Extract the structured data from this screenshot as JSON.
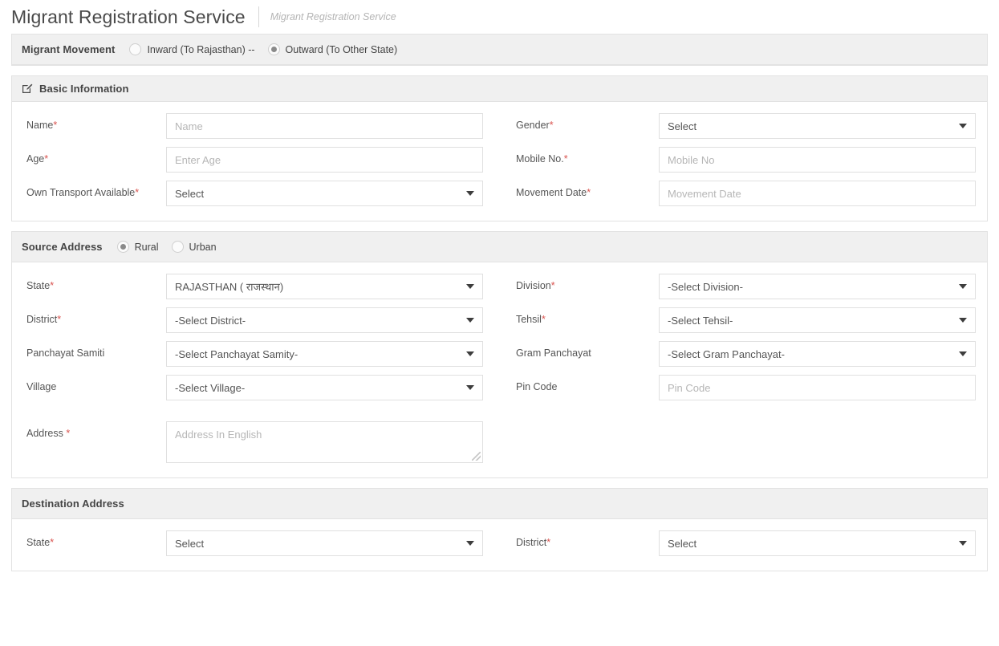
{
  "header": {
    "title": "Migrant Registration Service",
    "subtitle": "Migrant Registration Service"
  },
  "movement": {
    "label": "Migrant Movement",
    "options": [
      {
        "label": "Inward (To Rajasthan) --",
        "selected": false
      },
      {
        "label": "Outward (To Other State)",
        "selected": true
      }
    ]
  },
  "basic": {
    "section_title": "Basic Information",
    "icon": "edit-square-icon",
    "fields": {
      "name_label": "Name",
      "name_placeholder": "Name",
      "gender_label": "Gender",
      "gender_value": "Select",
      "age_label": "Age",
      "age_placeholder": "Enter Age",
      "mobile_label": "Mobile No.",
      "mobile_placeholder": "Mobile No",
      "transport_label": "Own Transport Available",
      "transport_value": "Select",
      "movement_date_label": "Movement Date",
      "movement_date_placeholder": "Movement Date"
    }
  },
  "source": {
    "section_title": "Source Address",
    "area_options": [
      {
        "label": "Rural",
        "selected": true
      },
      {
        "label": "Urban",
        "selected": false
      }
    ],
    "fields": {
      "state_label": "State",
      "state_value": "RAJASTHAN ( राजस्थान)",
      "division_label": "Division",
      "division_value": "-Select Division-",
      "district_label": "District",
      "district_value": "-Select District-",
      "tehsil_label": "Tehsil",
      "tehsil_value": "-Select Tehsil-",
      "panchayat_samiti_label": "Panchayat Samiti",
      "panchayat_samiti_value": "-Select Panchayat Samity-",
      "gram_panchayat_label": "Gram Panchayat",
      "gram_panchayat_value": "-Select Gram Panchayat-",
      "village_label": "Village",
      "village_value": "-Select Village-",
      "pincode_label": "Pin Code",
      "pincode_placeholder": "Pin Code",
      "address_label": "Address",
      "address_placeholder": "Address In English"
    }
  },
  "destination": {
    "section_title": "Destination Address",
    "fields": {
      "state_label": "State",
      "state_value": "Select",
      "district_label": "District",
      "district_value": "Select"
    }
  },
  "colors": {
    "required_asterisk": "#d9534f",
    "panel_bar_bg": "#f0f0f0",
    "border": "#e2e2e2",
    "text": "#555555"
  }
}
